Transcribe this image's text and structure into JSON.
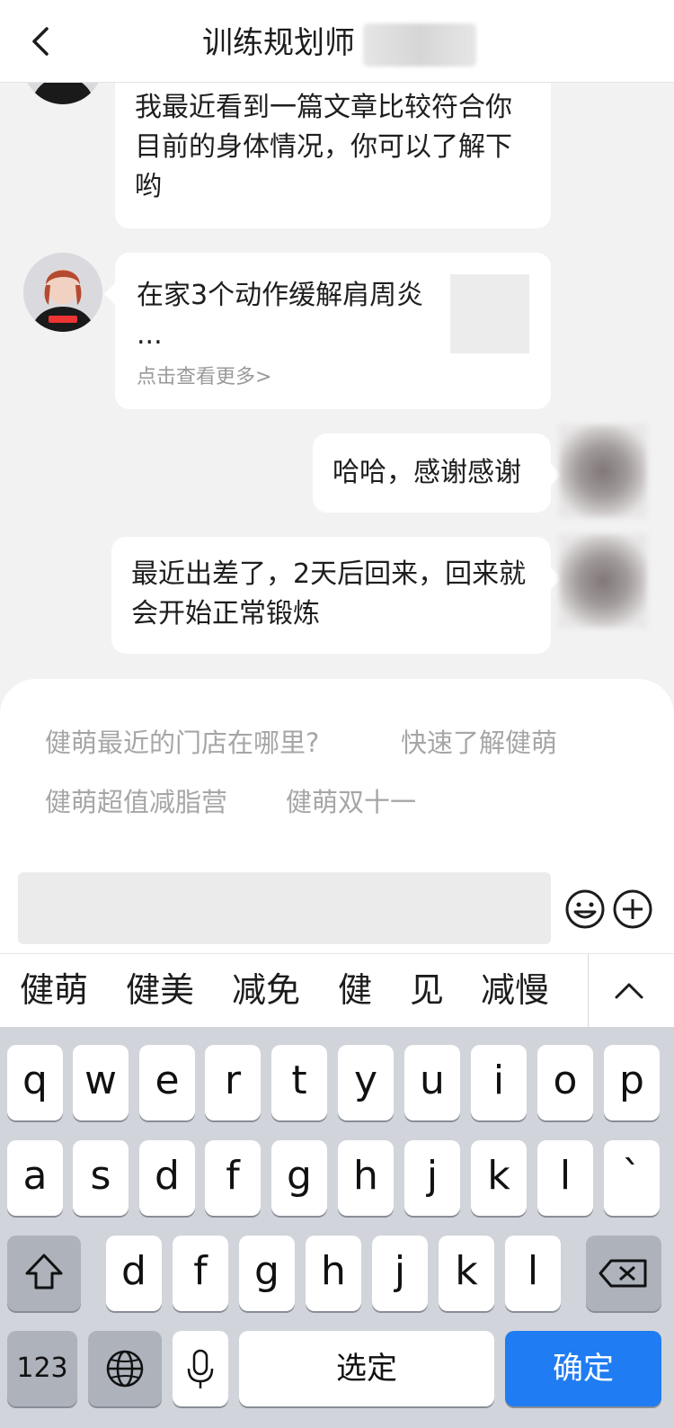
{
  "header": {
    "title": "训练规划师"
  },
  "messages": {
    "m1": "我最近看到一篇文章比较符合你目前的身体情况，你可以了解下哟",
    "m2_title": "在家3个动作缓解肩周炎 ...",
    "m2_more": "点击查看更多>",
    "m3": "哈哈，感谢感谢",
    "m4": "最近出差了，2天后回来，回来就会开始正常锻炼"
  },
  "quick_replies": [
    "健萌最近的门店在哪里?",
    "快速了解健萌",
    "健萌超值减脂营",
    "健萌双十一"
  ],
  "candidates": [
    "健萌",
    "健美",
    "减免",
    "健",
    "见",
    "减慢"
  ],
  "keyboard": {
    "row1": [
      "q",
      "w",
      "e",
      "r",
      "t",
      "y",
      "u",
      "i",
      "o",
      "p"
    ],
    "row2": [
      "a",
      "s",
      "d",
      "f",
      "g",
      "h",
      "j",
      "k",
      "l",
      "`"
    ],
    "row3": [
      "d",
      "f",
      "g",
      "h",
      "j",
      "k",
      "l"
    ],
    "numbers_label": "123",
    "space_label": "选定",
    "confirm_label": "确定"
  },
  "colors": {
    "accent": "#1f7cf2",
    "chat_bg": "#f2f2f2"
  }
}
